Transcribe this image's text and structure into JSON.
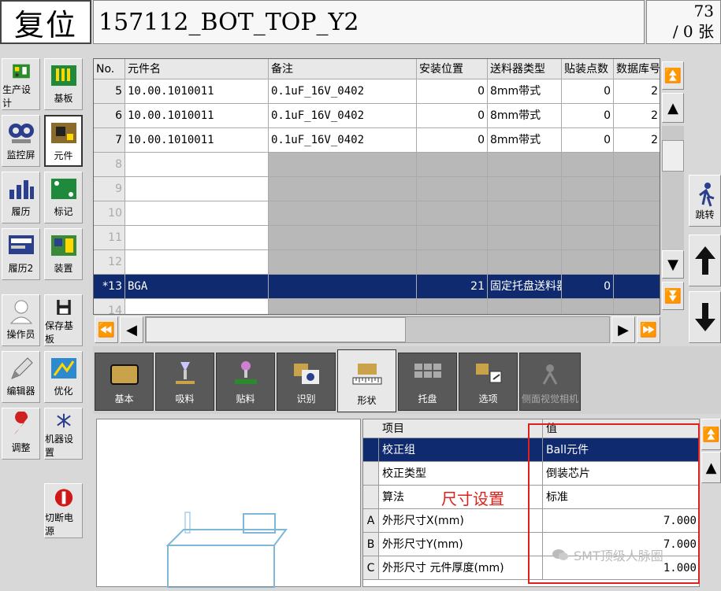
{
  "title": {
    "reset_label": "复位",
    "program_name": "157112_BOT_TOP_Y2",
    "count": "73",
    "count_unit": "/ 0 张"
  },
  "sidebar": {
    "items": [
      {
        "label": "生产设计"
      },
      {
        "label": "基板"
      },
      {
        "label": "监控屏"
      },
      {
        "label": "元件"
      },
      {
        "label": "履历"
      },
      {
        "label": "标记"
      },
      {
        "label": "履历2"
      },
      {
        "label": "装置"
      },
      {
        "label": "操作员"
      },
      {
        "label": "保存基板"
      },
      {
        "label": "编辑器"
      },
      {
        "label": "优化"
      },
      {
        "label": "调整"
      },
      {
        "label": "机器设置"
      },
      {
        "label": "切断电源"
      }
    ]
  },
  "grid": {
    "headers": [
      "No.",
      "元件名",
      "备注",
      "安装位置",
      "送料器类型",
      "贴装点数",
      "数据库号"
    ],
    "rows": [
      {
        "no": "5",
        "name": "10.00.1010011",
        "note": "0.1uF_16V_0402",
        "pos": "0",
        "feeder": "8mm带式",
        "count": "0",
        "db": "2"
      },
      {
        "no": "6",
        "name": "10.00.1010011",
        "note": "0.1uF_16V_0402",
        "pos": "0",
        "feeder": "8mm带式",
        "count": "0",
        "db": "2"
      },
      {
        "no": "7",
        "name": "10.00.1010011",
        "note": "0.1uF_16V_0402",
        "pos": "0",
        "feeder": "8mm带式",
        "count": "0",
        "db": "2"
      },
      {
        "no": "8",
        "name": "",
        "note": "",
        "pos": "",
        "feeder": "",
        "count": "",
        "db": ""
      },
      {
        "no": "9",
        "name": "",
        "note": "",
        "pos": "",
        "feeder": "",
        "count": "",
        "db": ""
      },
      {
        "no": "10",
        "name": "",
        "note": "",
        "pos": "",
        "feeder": "",
        "count": "",
        "db": ""
      },
      {
        "no": "11",
        "name": "",
        "note": "",
        "pos": "",
        "feeder": "",
        "count": "",
        "db": ""
      },
      {
        "no": "12",
        "name": "",
        "note": "",
        "pos": "",
        "feeder": "",
        "count": "",
        "db": ""
      },
      {
        "no": "*13",
        "name": "BGA",
        "note": "",
        "pos": "21",
        "feeder": "固定托盘送料器",
        "count": "0",
        "db": ""
      },
      {
        "no": "14",
        "name": "",
        "note": "",
        "pos": "",
        "feeder": "",
        "count": "",
        "db": ""
      }
    ]
  },
  "right_panel": {
    "jump_label": "跳转"
  },
  "tabs": [
    {
      "label": "基本"
    },
    {
      "label": "吸料"
    },
    {
      "label": "贴料"
    },
    {
      "label": "识别"
    },
    {
      "label": "形状"
    },
    {
      "label": "托盘"
    },
    {
      "label": "选项"
    },
    {
      "label": "侧面视觉相机"
    }
  ],
  "props": {
    "header_item": "项目",
    "header_value": "值",
    "rows": [
      {
        "key": "",
        "item": "校正组",
        "value": "Ball元件"
      },
      {
        "key": "",
        "item": "校正类型",
        "value": "倒装芯片"
      },
      {
        "key": "",
        "item": "算法",
        "value": "标准"
      },
      {
        "key": "A",
        "item": "外形尺寸X(mm)",
        "value": "7.000"
      },
      {
        "key": "B",
        "item": "外形尺寸Y(mm)",
        "value": "7.000"
      },
      {
        "key": "C",
        "item": "外形尺寸 元件厚度(mm)",
        "value": "1.000"
      }
    ]
  },
  "annotation": {
    "text": "尺寸设置",
    "color": "#e0201a"
  },
  "watermark": {
    "text": "SMT顶级人脉圈"
  },
  "colors": {
    "selection": "#0f2a6e",
    "tab_dark": "#595959",
    "annotation_box": "#e0201a"
  }
}
